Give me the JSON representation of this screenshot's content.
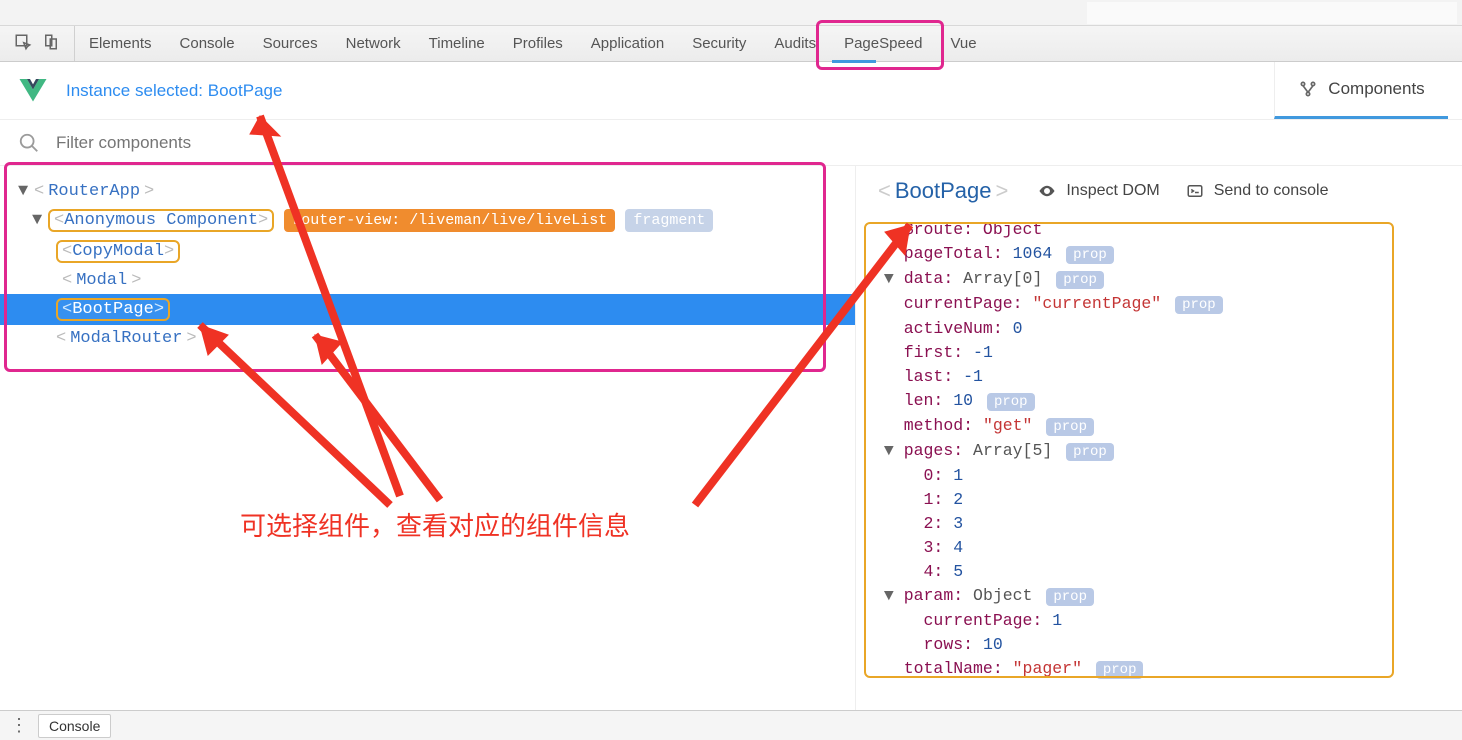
{
  "devtools_tabs": [
    "Elements",
    "Console",
    "Sources",
    "Network",
    "Timeline",
    "Profiles",
    "Application",
    "Security",
    "Audits",
    "PageSpeed",
    "Vue"
  ],
  "active_devtools_tab": "Vue",
  "vue_bar": {
    "instance_msg": "Instance selected: BootPage",
    "components_tab": "Components"
  },
  "filter": {
    "placeholder": "Filter components"
  },
  "tree": {
    "root": "RouterApp",
    "anon": "Anonymous Component",
    "router_view_badge": "router-view: /liveman/live/liveList",
    "fragment_badge": "fragment",
    "copy_modal": "CopyModal",
    "modal": "Modal",
    "boot_page": "BootPage",
    "modal_router": "ModalRouter"
  },
  "annotation_text": "可选择组件，查看对应的组件信息",
  "right": {
    "selected_component": "BootPage",
    "inspect_dom": "Inspect DOM",
    "send_to_console": "Send to console",
    "prop_label": "prop",
    "lines": {
      "route": "$route: Object",
      "pageTotal_k": "pageTotal:",
      "pageTotal_v": "1064",
      "data": "data: Array[0]",
      "currentPage_k": "currentPage:",
      "currentPage_v": "\"currentPage\"",
      "activeNum_k": "activeNum:",
      "activeNum_v": "0",
      "first_k": "first:",
      "first_v": "-1",
      "last_k": "last:",
      "last_v": "-1",
      "len_k": "len:",
      "len_v": "10",
      "method_k": "method:",
      "method_v": "\"get\"",
      "pages": "pages: Array[5]",
      "p0": "0: 1",
      "p1": "1: 2",
      "p2": "2: 3",
      "p3": "3: 4",
      "p4": "4: 5",
      "param": "param: Object",
      "param_cp_k": "currentPage:",
      "param_cp_v": "1",
      "param_rows_k": "rows:",
      "param_rows_v": "10",
      "totalName_k": "totalName:",
      "totalName_v": "\"pager\""
    }
  },
  "bottom": {
    "console": "Console"
  }
}
